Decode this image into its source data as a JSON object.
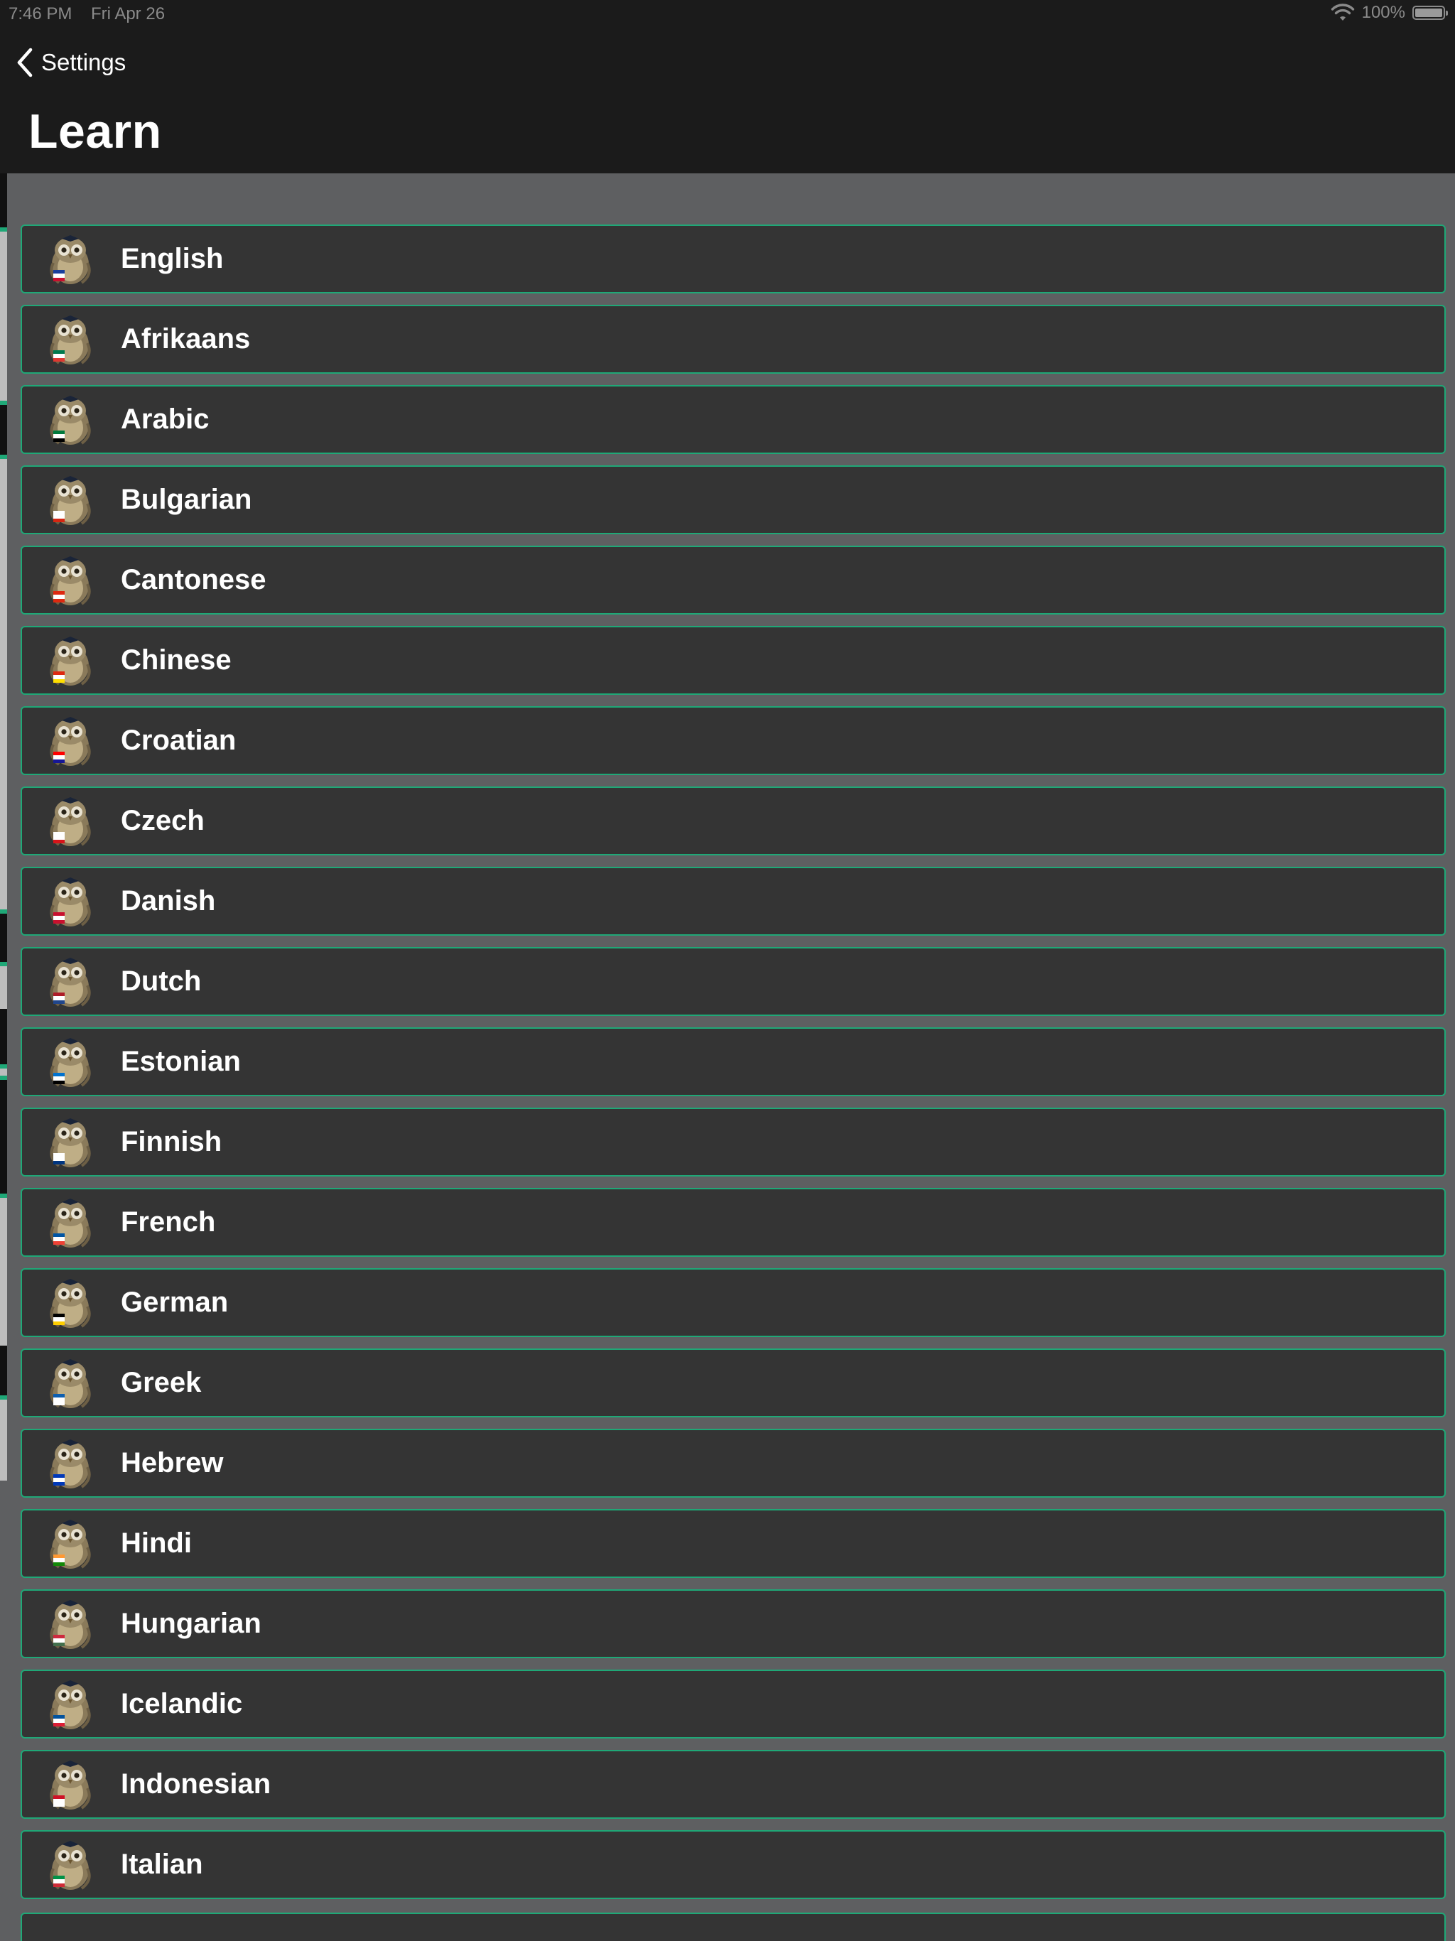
{
  "status_bar": {
    "time": "7:46 PM",
    "date": "Fri Apr 26",
    "battery": "100%"
  },
  "nav": {
    "back_label": "Settings",
    "title": "Learn"
  },
  "colors": {
    "nav_background": "#1b1b1b",
    "page_background": "#5e5f61",
    "row_background": "#343434",
    "row_border": "#1fa877",
    "text": "#ffffff"
  },
  "languages": [
    {
      "label": "English",
      "flag": "gb-flag"
    },
    {
      "label": "Afrikaans",
      "flag": "za-flag"
    },
    {
      "label": "Arabic",
      "flag": "arabic-flag"
    },
    {
      "label": "Bulgarian",
      "flag": "bg-flag"
    },
    {
      "label": "Cantonese",
      "flag": "hk-flag"
    },
    {
      "label": "Chinese",
      "flag": "cn-flag"
    },
    {
      "label": "Croatian",
      "flag": "hr-flag"
    },
    {
      "label": "Czech",
      "flag": "cz-flag"
    },
    {
      "label": "Danish",
      "flag": "dk-flag"
    },
    {
      "label": "Dutch",
      "flag": "nl-flag"
    },
    {
      "label": "Estonian",
      "flag": "ee-flag"
    },
    {
      "label": "Finnish",
      "flag": "fi-flag"
    },
    {
      "label": "French",
      "flag": "fr-flag"
    },
    {
      "label": "German",
      "flag": "de-flag"
    },
    {
      "label": "Greek",
      "flag": "gr-flag"
    },
    {
      "label": "Hebrew",
      "flag": "il-flag"
    },
    {
      "label": "Hindi",
      "flag": "in-flag"
    },
    {
      "label": "Hungarian",
      "flag": "hu-flag"
    },
    {
      "label": "Icelandic",
      "flag": "is-flag"
    },
    {
      "label": "Indonesian",
      "flag": "id-flag"
    },
    {
      "label": "Italian",
      "flag": "it-flag"
    }
  ]
}
